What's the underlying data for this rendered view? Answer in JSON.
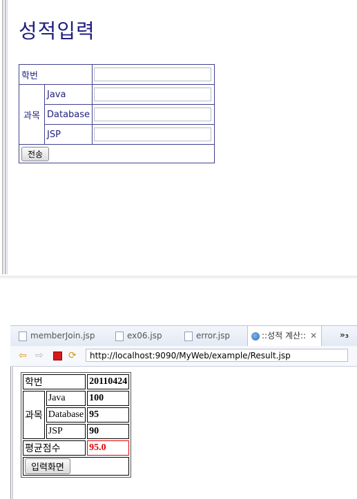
{
  "form": {
    "title": "성적입력",
    "student_id_label": "학번",
    "subject_label": "과목",
    "subjects": [
      "Java",
      "Database",
      "JSP"
    ],
    "submit_label": "전송"
  },
  "browser": {
    "tabs": [
      {
        "label": "memberJoin.jsp"
      },
      {
        "label": "ex06.jsp"
      },
      {
        "label": "error.jsp"
      },
      {
        "label": "::성적 계산::",
        "active": true
      }
    ],
    "close_glyph": "✕",
    "overflow_label": "»₃",
    "url": "http://localhost:9090/MyWeb/example/Result.jsp"
  },
  "result": {
    "student_id_label": "학번",
    "student_id_value": "20110424",
    "subject_label": "과목",
    "rows": [
      {
        "subject": "Java",
        "score": "100"
      },
      {
        "subject": "Database",
        "score": "95"
      },
      {
        "subject": "JSP",
        "score": "90"
      }
    ],
    "average_label": "평균점수",
    "average_value": "95.0",
    "back_label": "입력화면",
    "average_color": "#e00000"
  }
}
